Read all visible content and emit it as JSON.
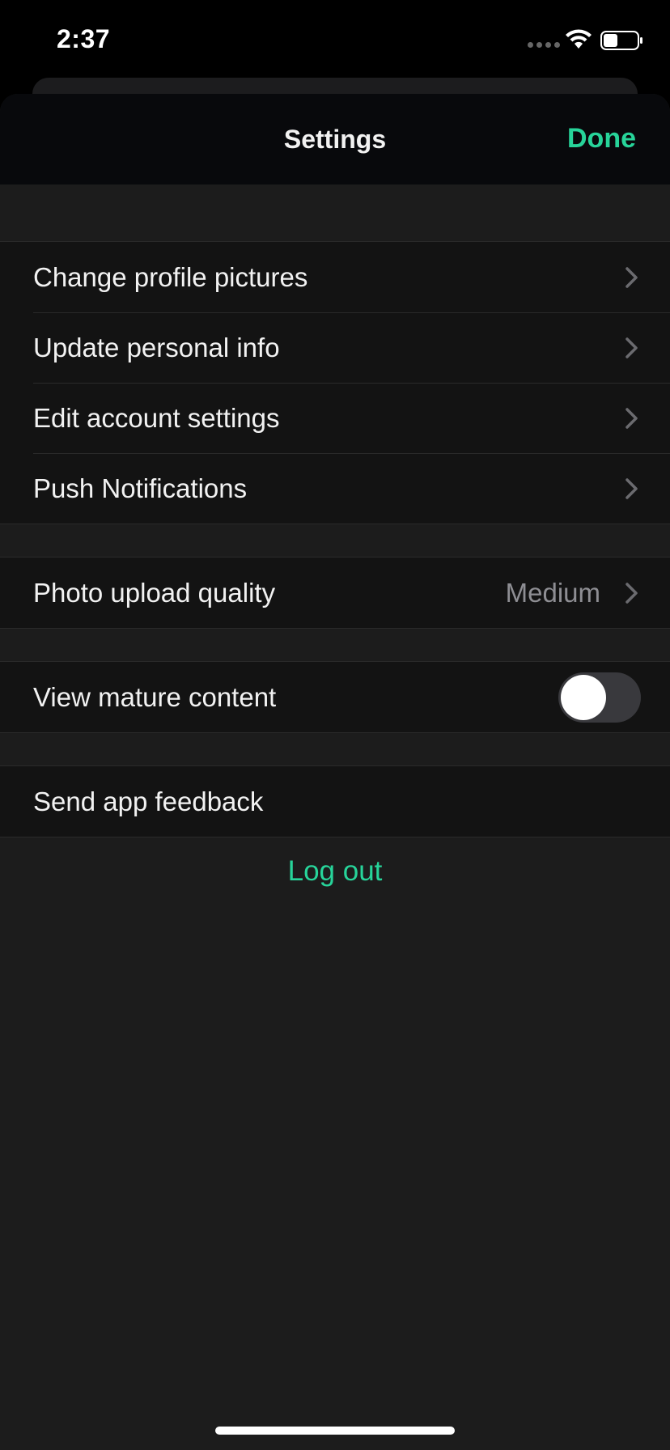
{
  "status_bar": {
    "time": "2:37",
    "icons": [
      "cellular-signal-icon",
      "wifi-icon",
      "battery-icon"
    ]
  },
  "nav": {
    "title": "Settings",
    "done_label": "Done"
  },
  "groups": [
    {
      "rows": [
        {
          "label": "Change profile pictures",
          "chevron": true
        },
        {
          "label": "Update personal info",
          "chevron": true
        },
        {
          "label": "Edit account settings",
          "chevron": true
        },
        {
          "label": "Push Notifications",
          "chevron": true
        }
      ]
    },
    {
      "rows": [
        {
          "label": "Photo upload quality",
          "value": "Medium",
          "chevron": true
        }
      ]
    },
    {
      "rows": [
        {
          "label": "View mature content",
          "toggle": false
        }
      ]
    },
    {
      "rows": [
        {
          "label": "Send app feedback"
        }
      ]
    }
  ],
  "logout_label": "Log out",
  "colors": {
    "accent": "#27d49a",
    "background": "#1c1c1c",
    "row_background": "#131313",
    "secondary_text": "#8e8e93"
  }
}
